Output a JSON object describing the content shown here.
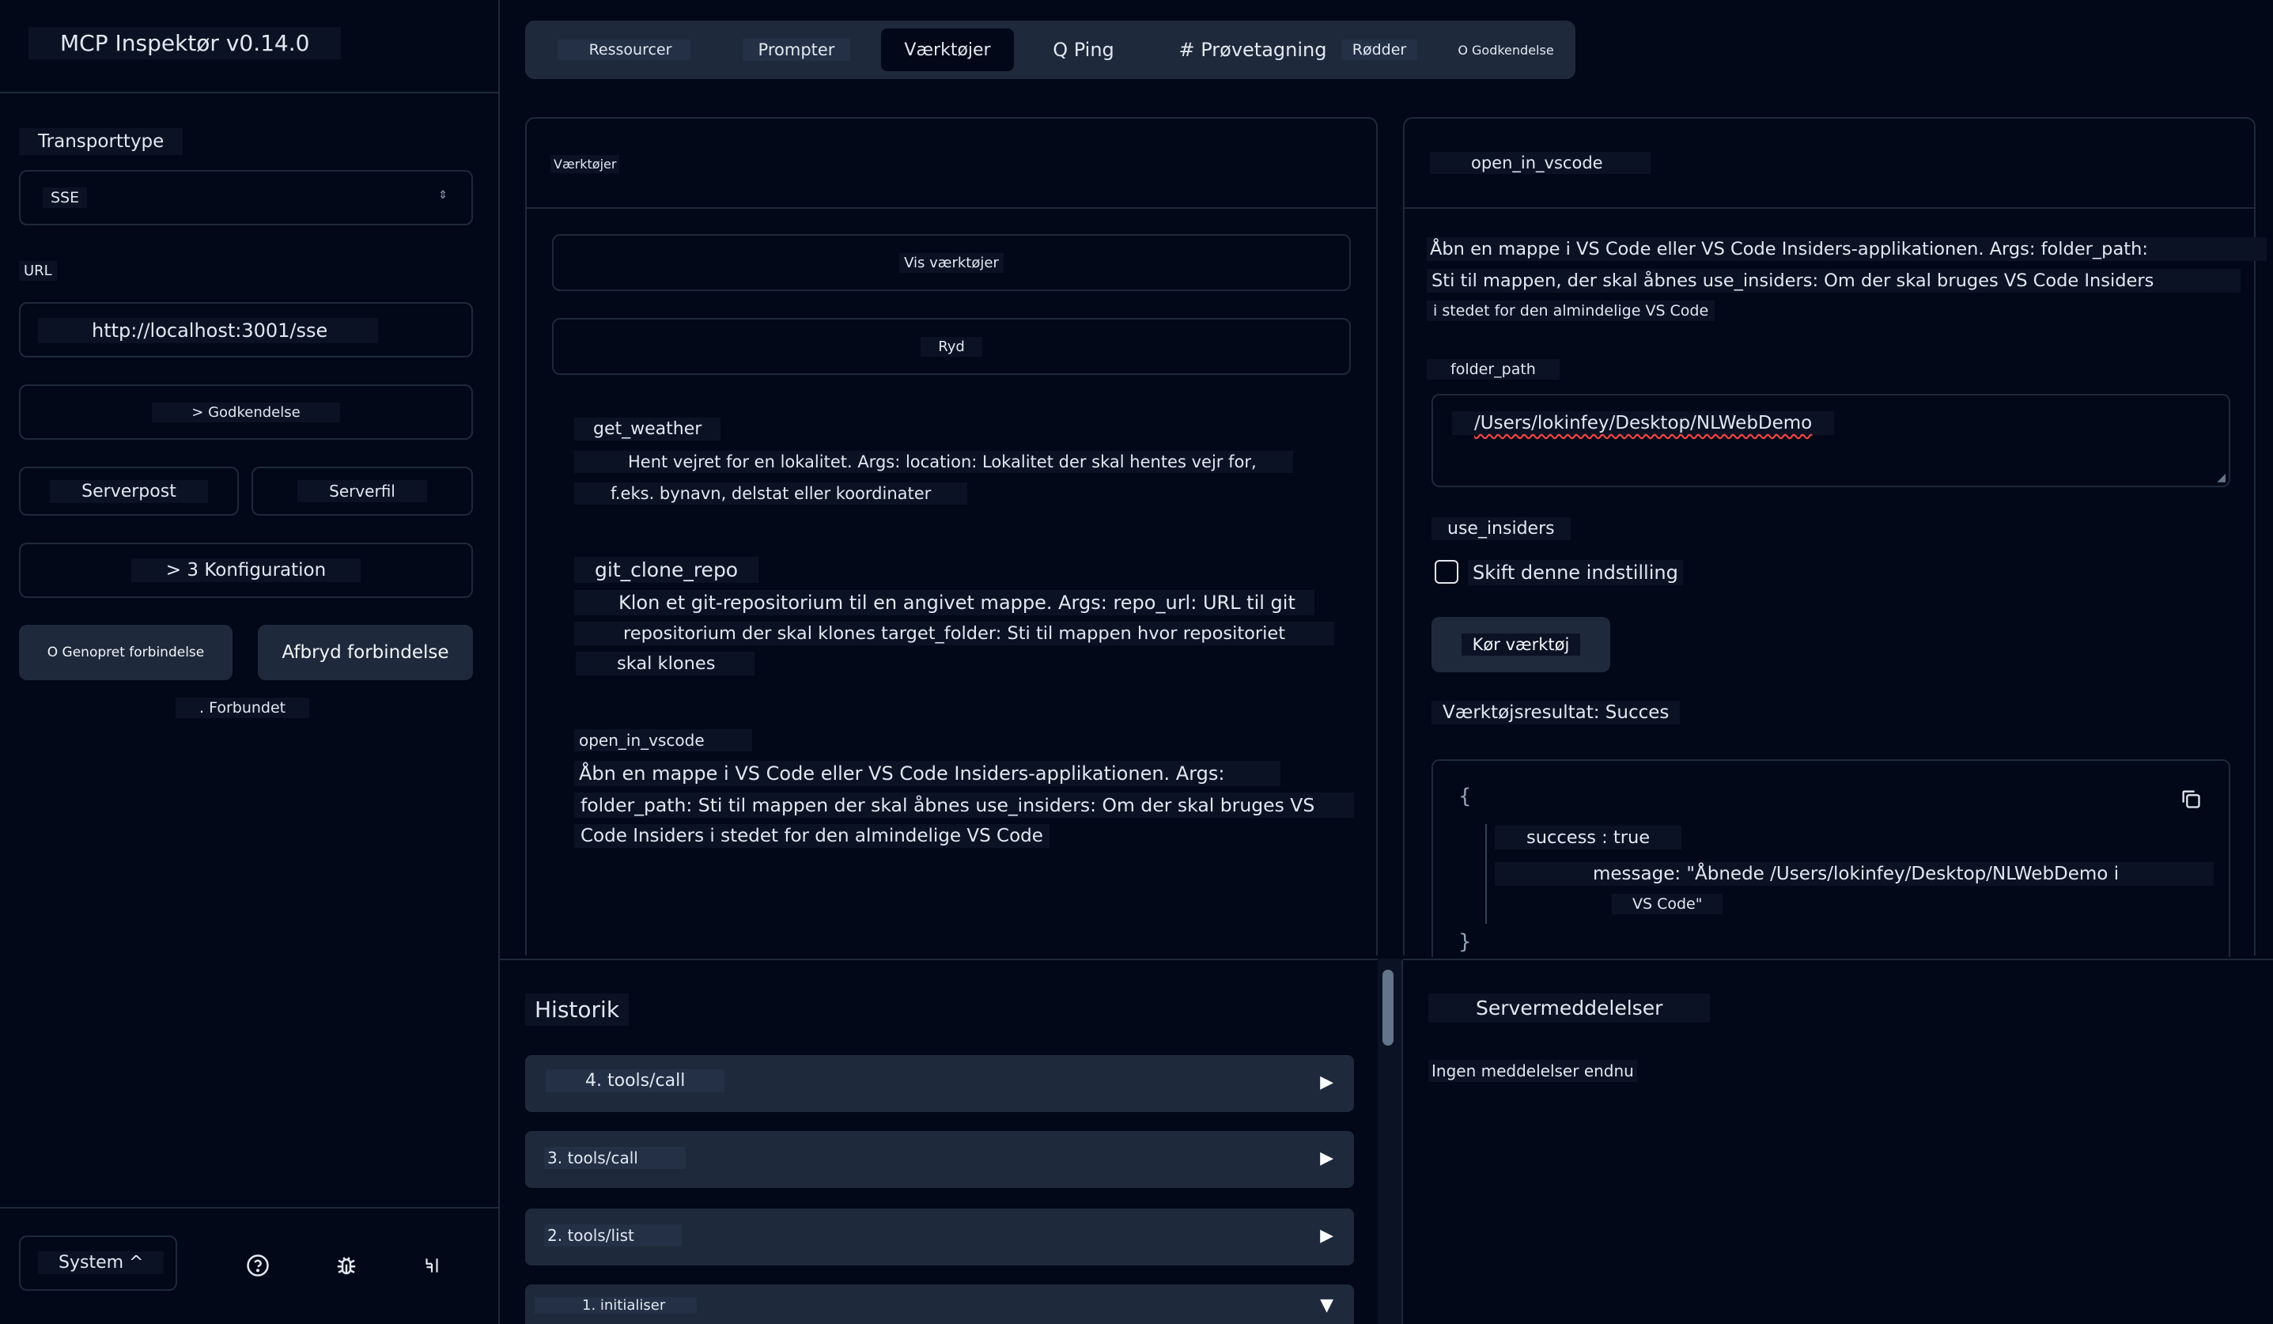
{
  "sidebar": {
    "title": "MCP Inspektør v0.14.0",
    "transport_label": "Transporttype",
    "transport_value": "SSE",
    "url_label": "URL",
    "url_value": "http://localhost:3001/sse",
    "auth_button": "> Godkendelse",
    "server_entry_button": "Serverpost",
    "server_file_button": "Serverfil",
    "config_button": "> 3 Konfiguration",
    "reconnect_button": "O Genopret forbindelse",
    "disconnect_button": "Afbryd forbindelse",
    "status_text": ". Forbundet",
    "theme_select": "System ^"
  },
  "tabs": [
    {
      "label": "Ressourcer"
    },
    {
      "label": "Prompter"
    },
    {
      "label": "Værktøjer"
    },
    {
      "label": "Q Ping"
    },
    {
      "label": "# Prøvetagning"
    },
    {
      "label": "Rødder"
    },
    {
      "label": "O Godkendelse"
    }
  ],
  "tools_panel": {
    "title": "Værktøjer",
    "list_button": "Vis værktøjer",
    "clear_button": "Ryd",
    "tools": [
      {
        "name": "get_weather",
        "desc1": "Hent vejret for en lokalitet. Args: location: Lokalitet der skal hentes vejr for,",
        "desc2": "f.eks. bynavn, delstat eller koordinater"
      },
      {
        "name": "git_clone_repo",
        "desc1": "Klon et git-repositorium til en angivet mappe. Args: repo_url: URL til git",
        "desc2": "repositorium der skal klones target_folder: Sti til mappen hvor repositoriet",
        "desc3": "skal klones"
      },
      {
        "name": "open_in_vscode",
        "desc1": "Åbn en mappe i VS Code eller VS Code Insiders-applikationen. Args:",
        "desc2": "folder_path: Sti til mappen der skal åbnes use_insiders: Om der skal bruges VS",
        "desc3": "Code Insiders i stedet for den almindelige VS Code"
      }
    ]
  },
  "detail_panel": {
    "title": "open_in_vscode",
    "desc1": "Åbn en mappe i VS Code eller VS Code Insiders-applikationen. Args: folder_path:",
    "desc2": "Sti til mappen, der skal åbnes use_insiders: Om der skal bruges VS Code Insiders",
    "desc3": "i stedet for den almindelige VS Code",
    "folder_label": "folder_path",
    "folder_value": "/Users/lokinfey/Desktop/NLWebDemo",
    "insiders_label": "use_insiders",
    "toggle_label": "Skift denne indstilling",
    "run_button": "Kør værktøj",
    "result_label": "Værktøjsresultat: Succes",
    "result_open": "{",
    "result_success": "success : true",
    "result_message1": "message: \"Åbnede /Users/lokinfey/Desktop/NLWebDemo i",
    "result_message2": "VS Code\"",
    "result_close": "}"
  },
  "history": {
    "title": "Historik",
    "items": [
      {
        "label": "4. tools/call",
        "arrow": "▶"
      },
      {
        "label": "3. tools/call",
        "arrow": "▶"
      },
      {
        "label": "2. tools/list",
        "arrow": "▶"
      },
      {
        "label": "1. initialiser",
        "arrow": "▼"
      }
    ]
  },
  "notifications": {
    "title": "Servermeddelelser",
    "empty": "Ingen meddelelser endnu"
  },
  "icons": {
    "help": "help-circle-icon",
    "bug": "bug-icon",
    "github": "github-icon",
    "copy": "copy-icon"
  },
  "colors": {
    "background": "#020817",
    "border": "#1e293b",
    "button": "#1e293b",
    "text": "#e2e8f0"
  }
}
